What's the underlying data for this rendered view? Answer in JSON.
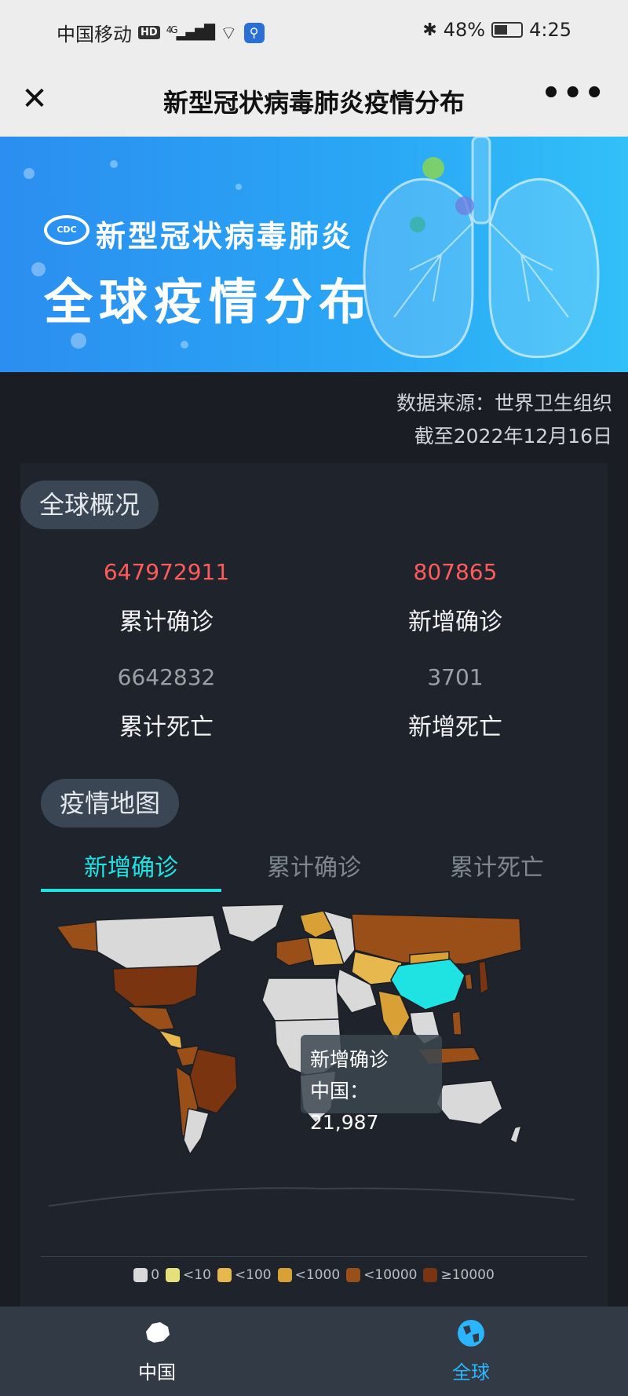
{
  "status_bar": {
    "carrier": "中国移动",
    "hd": "HD",
    "network": "4G",
    "battery": "48%",
    "time": "4:25"
  },
  "title_bar": {
    "close_label": "✕",
    "title": "新型冠状病毒肺炎疫情分布",
    "more_label": "•••"
  },
  "banner": {
    "logo_text": "CDC",
    "line1": "新型冠状病毒肺炎",
    "line2": "全球疫情分布"
  },
  "source": {
    "line1": "数据来源：世界卫生组织",
    "line2": "截至2022年12月16日"
  },
  "overview": {
    "heading": "全球概况",
    "stats": [
      {
        "value": "647972911",
        "label": "累计确诊"
      },
      {
        "value": "807865",
        "label": "新增确诊"
      },
      {
        "value": "6642832",
        "label": "累计死亡"
      },
      {
        "value": "3701",
        "label": "新增死亡"
      }
    ]
  },
  "map_section": {
    "heading": "疫情地图",
    "tabs": [
      {
        "label": "新增确诊",
        "active": true
      },
      {
        "label": "累计确诊",
        "active": false
      },
      {
        "label": "累计死亡",
        "active": false
      }
    ],
    "tooltip": {
      "title": "新增确诊",
      "value": "中国：21,987"
    },
    "legend": [
      {
        "label": "0",
        "color": "#d9d9d9"
      },
      {
        "label": "<10",
        "color": "#e6e07a"
      },
      {
        "label": "<100",
        "color": "#e6b84d"
      },
      {
        "label": "<1000",
        "color": "#d9a035"
      },
      {
        "label": "<10000",
        "color": "#9a4f18"
      },
      {
        "label": "≥10000",
        "color": "#7a3510"
      }
    ],
    "highlight_color": "#1fe3e3"
  },
  "bottom_nav": {
    "items": [
      {
        "label": "中国",
        "active": false
      },
      {
        "label": "全球",
        "active": true
      }
    ],
    "active_color": "#2bb5ff"
  }
}
